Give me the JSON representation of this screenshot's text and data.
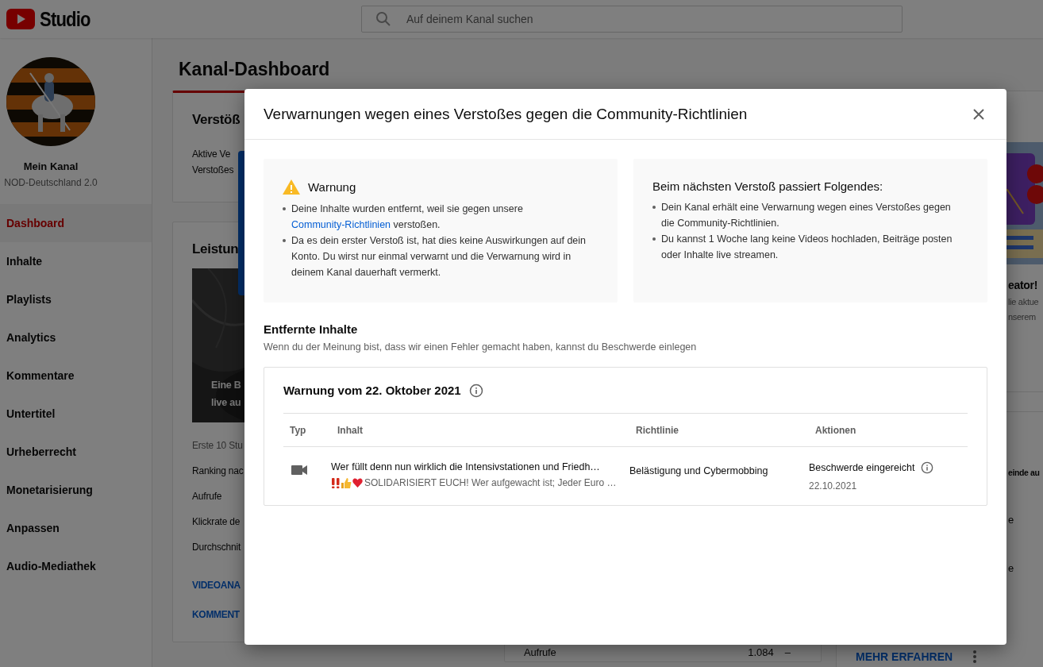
{
  "header": {
    "logo_text": "Studio",
    "search": {
      "placeholder": "Auf deinem Kanal suchen"
    }
  },
  "sidebar": {
    "channel_label": "Mein Kanal",
    "channel_name": "NOD-Deutschland 2.0",
    "items": [
      {
        "label": "Dashboard",
        "selected": true
      },
      {
        "label": "Inhalte",
        "selected": false
      },
      {
        "label": "Playlists",
        "selected": false
      },
      {
        "label": "Analytics",
        "selected": false
      },
      {
        "label": "Kommentare",
        "selected": false
      },
      {
        "label": "Untertitel",
        "selected": false
      },
      {
        "label": "Urheberrecht",
        "selected": false
      },
      {
        "label": "Monetarisierung",
        "selected": false
      },
      {
        "label": "Anpassen",
        "selected": false
      },
      {
        "label": "Audio-Mediathek",
        "selected": false
      }
    ]
  },
  "page_title": "Kanal-Dashboard",
  "violations_card": {
    "title": "Verstöß",
    "lines": [
      "Aktive Ve",
      "Verstoßes"
    ]
  },
  "performance_card": {
    "title": "Leistun",
    "video_caption": [
      "Eine B",
      "live au"
    ],
    "note": "Erste 10 Stu",
    "metrics": [
      "Ranking nac",
      "Aufrufe",
      "Klickrate de",
      "Durchschnit"
    ],
    "links": [
      "VIDEOANA",
      "KOMMENT"
    ]
  },
  "middle_card": {
    "metric": {
      "label": "Aufrufe",
      "value": "1.084",
      "trend": "–"
    }
  },
  "right_card": {
    "title": "eator!",
    "lines": [
      "lie aktue",
      "nserem"
    ],
    "section_title": "einde au",
    "items": [
      "e",
      "e"
    ],
    "link": "MEHR ERFAHREN"
  },
  "dialog": {
    "title": "Verwarnungen wegen eines Verstoßes gegen die Community-Richtlinien",
    "warning_box": {
      "title": "Warnung",
      "bullets": [
        {
          "text": "Deine Inhalte wurden entfernt, weil sie gegen unsere ",
          "link": "Community-Richtlinien",
          "text_after": " verstoßen."
        },
        {
          "text": "Da es dein erster Verstoß ist, hat dies keine Auswirkungen auf dein Konto. Du wirst nur einmal verwarnt und die Verwarnung wird in deinem Kanal dauerhaft vermerkt."
        }
      ]
    },
    "next_box": {
      "title": "Beim nächsten Verstoß passiert Folgendes:",
      "bullets": [
        {
          "text": "Dein Kanal erhält eine Verwarnung wegen eines Verstoßes gegen die Community-Richtlinien."
        },
        {
          "text": "Du kannst 1 Woche lang keine Videos hochladen, Beiträge posten oder Inhalte live streamen."
        }
      ]
    },
    "removed": {
      "title": "Entfernte Inhalte",
      "subtitle": "Wenn du der Meinung bist, dass wir einen Fehler gemacht haben, kannst du Beschwerde einlegen",
      "strike": {
        "title": "Warnung vom 22. Oktober 2021",
        "columns": [
          "Typ",
          "Inhalt",
          "Richtlinie",
          "Aktionen"
        ],
        "rows": [
          {
            "kind": "video",
            "title": "Wer füllt denn nun wirklich die Intensivstationen und Friedh…",
            "description": "SOLIDARISIERT EUCH! Wer aufgewacht ist; Jeder Euro …",
            "policy": "Belästigung und Cybermobbing",
            "action": "Beschwerde eingereicht",
            "date": "22.10.2021"
          }
        ]
      }
    }
  }
}
